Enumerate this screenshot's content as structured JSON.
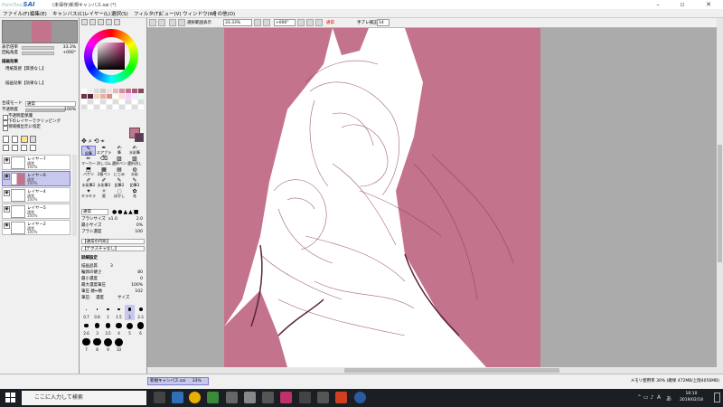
{
  "app": {
    "logo_sub": "PaintTool",
    "logo": "SAI",
    "title": "(未保存)新規キャンバス.sai (*)",
    "win_min": "–",
    "win_max": "▫",
    "win_close": "✕"
  },
  "menu": [
    "ファイル(F)",
    "編集(E)",
    "キャンバス(C)",
    "レイヤー(L)",
    "選択(S)",
    "フィルタ(T)",
    "ビュー(V)",
    "ウィンドウ(W)",
    "その他(O)"
  ],
  "canvas_toolbar": {
    "selection_label": "選択範囲表示",
    "zoom": "33.33%",
    "angle": "+000°",
    "mode": "通常",
    "stabilizer_label": "手ブレ補正",
    "stabilizer_value": "14"
  },
  "nav": {
    "zoom_label": "表示倍率",
    "zoom_value": "33.3%",
    "angle_label": "回転角度",
    "angle_value": "+000°"
  },
  "layer_props": {
    "fx_label": "描画効果",
    "texture": "用紙質感【質感なし】",
    "effect": "描画効果【効果なし】",
    "blend_label": "合成モード",
    "blend_value": "通常",
    "opacity_label": "不透明度",
    "opacity_value": "100%",
    "check1": "不透明度保護",
    "check2": "下のレイヤーでクリッピング",
    "check3": "領域検出元に指定"
  },
  "layers": [
    {
      "name": "レイヤー7",
      "mode": "通常",
      "opacity": "100%",
      "selected": false
    },
    {
      "name": "レイヤー6",
      "mode": "通常",
      "opacity": "100%",
      "selected": true
    },
    {
      "name": "レイヤー4",
      "mode": "通常",
      "opacity": "100%",
      "selected": false
    },
    {
      "name": "レイヤー5",
      "mode": "通常",
      "opacity": "100%",
      "selected": false
    },
    {
      "name": "レイヤー2",
      "mode": "通常",
      "opacity": "100%",
      "selected": false
    }
  ],
  "tools": [
    {
      "g": "✎",
      "l": "鉛筆"
    },
    {
      "g": "✒",
      "l": "エアブラシ"
    },
    {
      "g": "✍",
      "l": "筆"
    },
    {
      "g": "✍",
      "l": "水彩筆"
    },
    {
      "g": "✏",
      "l": "マーカー"
    },
    {
      "g": "⌫",
      "l": "消しゴム"
    },
    {
      "g": "▨",
      "l": "選択ペン"
    },
    {
      "g": "▧",
      "l": "選択消し"
    },
    {
      "g": "⬒",
      "l": "バケツ"
    },
    {
      "g": "▦",
      "l": "2値ペン"
    },
    {
      "g": "▤",
      "l": "にじみ"
    },
    {
      "g": "◍",
      "l": "水彩"
    },
    {
      "g": "✐",
      "l": "水彩筆2"
    },
    {
      "g": "✐",
      "l": "水彩筆3"
    },
    {
      "g": "✎",
      "l": "鉛筆2"
    },
    {
      "g": "✎",
      "l": "鉛筆3"
    },
    {
      "g": "✦",
      "l": "キラキラ"
    },
    {
      "g": "✧",
      "l": "星"
    },
    {
      "g": "◌",
      "l": "ぼかし"
    },
    {
      "g": "✿",
      "l": "花"
    }
  ],
  "brush": {
    "mode": "通常",
    "size_label": "ブラシサイズ",
    "size_mult": "x1.0",
    "size_value": "2.0",
    "min_label": "最小サイズ",
    "min_value": "0%",
    "density_label": "ブラシ濃度",
    "density_value": "100",
    "shape": "【通常の円形】",
    "texture": "【テクスチャなし】",
    "detail_label": "詳細設定",
    "quality_label": "描画品質",
    "quality_value": "3",
    "edge_label": "輪郭の硬さ",
    "edge_value": "80",
    "min_density_label": "最小濃度",
    "min_density_value": "0",
    "max_pressure_label": "最大濃度筆圧",
    "max_pressure_value": "100%",
    "hard_soft_label": "筆圧 硬⇔軟",
    "hard_soft_value": "102",
    "pressure_label": "筆圧:",
    "p_density": "濃度",
    "p_size": "サイズ"
  },
  "brush_sizes": [
    "0.7",
    "0.8",
    "1",
    "1.5",
    "2",
    "2.3",
    "2.6",
    "3",
    "3.5",
    "4",
    "5",
    "6",
    "7",
    "8",
    "9",
    "10"
  ],
  "status": {
    "doc_name": "新規キャンバス.sai",
    "doc_zoom": "33%",
    "memory": "メモリ使用率 30% (確保 472MB/上限4056MB)"
  },
  "taskbar": {
    "search": "ここに入力して検索",
    "time": "16:10",
    "date": "2019/02/18",
    "ime": "A",
    "ime2": "あ"
  },
  "colors": {
    "accent": "#c4738c",
    "selection": "#c8c8ee",
    "taskbar": "#1b1f23"
  }
}
